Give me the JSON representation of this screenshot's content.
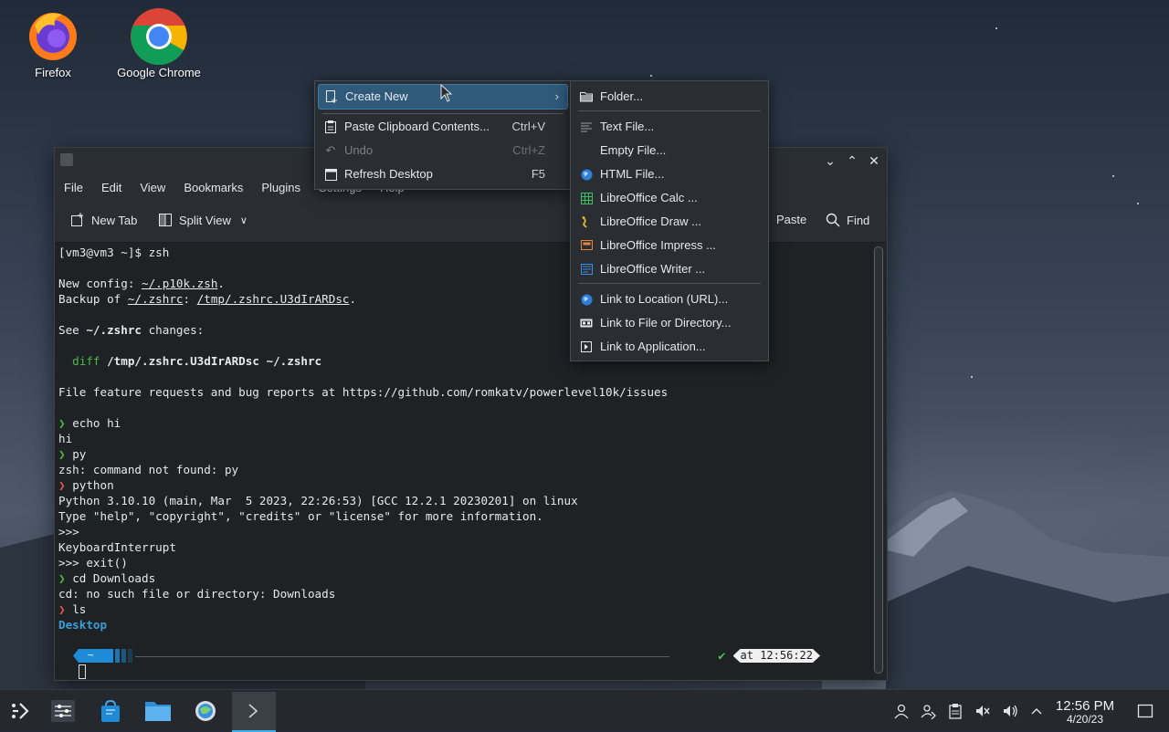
{
  "desktop": {
    "icons": [
      {
        "label": "Firefox"
      },
      {
        "label": "Google Chrome"
      }
    ]
  },
  "konsole": {
    "menu": [
      "File",
      "Edit",
      "View",
      "Bookmarks",
      "Plugins",
      "Settings",
      "Help"
    ],
    "toolbar": {
      "new_tab": "New Tab",
      "split_view": "Split View",
      "paste": "Paste",
      "find": "Find"
    },
    "terminal": {
      "l01": "[vm3@vm3 ~]$ zsh",
      "l02a": "New config: ",
      "l02b": "~/.p10k.zsh",
      "l02c": ".",
      "l03a": "Backup of ",
      "l03b": "~/.zshrc",
      "l03c": ": ",
      "l03d": "/tmp/.zshrc.U3dIrARDsc",
      "l03e": ".",
      "l04a": "See ",
      "l04b": "~/.zshrc",
      "l04c": " changes:",
      "l05a": "diff",
      "l05b": " /tmp/.zshrc.U3dIrARDsc ~/.zshrc",
      "l06": "File feature requests and bug reports at https://github.com/romkatv/powerlevel10k/issues",
      "prompt_glyph": "❯",
      "l07": "echo hi",
      "l08": "hi",
      "l09": "py",
      "l10": "zsh: command not found: py",
      "l11": "python",
      "l12": "Python 3.10.10 (main, Mar  5 2023, 22:26:53) [GCC 12.2.1 20230201] on linux",
      "l13": "Type \"help\", \"copyright\", \"credits\" or \"license\" for more information.",
      "l14": ">>>",
      "l15": "KeyboardInterrupt",
      "l16": ">>> exit()",
      "l17": "cd Downloads",
      "l18": "cd: no such file or directory: Downloads",
      "l19": "ls",
      "l20": "Desktop",
      "prompt_dir": "~",
      "check": "✔",
      "time_label": "at 12:56:22"
    }
  },
  "context_menu": {
    "create_new": "Create New",
    "paste": "Paste Clipboard Contents...",
    "paste_sc": "Ctrl+V",
    "undo": "Undo",
    "undo_sc": "Ctrl+Z",
    "refresh": "Refresh Desktop",
    "refresh_sc": "F5"
  },
  "submenu": {
    "folder": "Folder...",
    "text_file": "Text File...",
    "empty_file": "Empty File...",
    "html_file": "HTML File...",
    "calc": "LibreOffice Calc  ...",
    "draw": "LibreOffice Draw  ...",
    "impress": "LibreOffice Impress  ...",
    "writer": "LibreOffice Writer  ...",
    "link_url": "Link to Location (URL)...",
    "link_file": "Link to File or Directory...",
    "link_app": "Link to Application..."
  },
  "taskbar": {
    "time": "12:56 PM",
    "date": "4/20/23"
  },
  "colors": {
    "menu_highlight": "#2f5a7a",
    "terminal_bg": "#1f2224",
    "prompt_ok": "#4db84a",
    "prompt_err": "#e05555",
    "dir_color": "#3a9fd6"
  }
}
